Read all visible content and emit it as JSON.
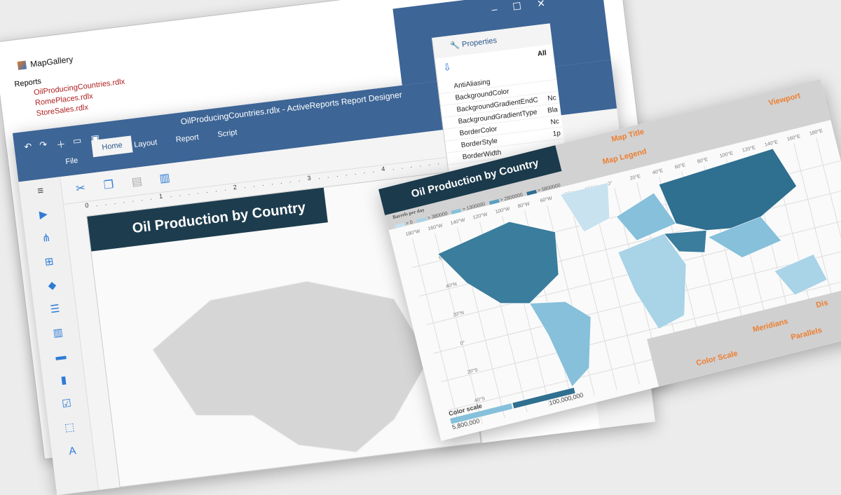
{
  "gallery": {
    "title": "MapGallery",
    "root": "Reports",
    "files": [
      "OilProducingCountries.rdlx",
      "RomePlaces.rdlx",
      "StoreSales.rdlx"
    ]
  },
  "designer": {
    "title": "OilProducingCountries.rdlx -  ActiveReports Report Designer",
    "tabs": {
      "file": "File",
      "home": "Home",
      "layout": "Layout",
      "report": "Report",
      "script": "Script"
    },
    "ruler": "0 . . . . . . . 1 . . . . . . . 2 . . . . . . . 3 . . . . . . . 4 . . . . . . . 5 . . . . . . .",
    "report_title": "Oil Production by Country",
    "properties": {
      "title": "Properties",
      "column": "All",
      "rows": [
        {
          "name": "AntiAliasing",
          "value": ""
        },
        {
          "name": "BackgroundColor",
          "value": ""
        },
        {
          "name": "BackgroundGradientEndC",
          "value": "Nc"
        },
        {
          "name": "BackgroundGradientType",
          "value": "Bla"
        },
        {
          "name": "BorderColor",
          "value": "Nc"
        },
        {
          "name": "BorderStyle",
          "value": "1p"
        },
        {
          "name": "BorderWidth",
          "value": ""
        }
      ]
    }
  },
  "map": {
    "title": "Oil Production by Country",
    "legend_title": "Barrels per day",
    "legend": [
      {
        "label": "> 0",
        "color": "#c8e2ef"
      },
      {
        "label": "> 380000",
        "color": "#a9d3e6"
      },
      {
        "label": "> 1300000",
        "color": "#86c0da"
      },
      {
        "label": "> 2800000",
        "color": "#5a9ebf"
      },
      {
        "label": "> 5800000",
        "color": "#2f6f90"
      }
    ],
    "meridians": [
      "180°W",
      "160°W",
      "140°W",
      "120°W",
      "100°W",
      "80°W",
      "60°W",
      "40°W",
      "20°W",
      "0°",
      "20°E",
      "40°E",
      "60°E",
      "80°E",
      "100°E",
      "120°E",
      "140°E",
      "160°E",
      "180°E"
    ],
    "parallels": [
      "60°N",
      "40°N",
      "20°N",
      "0°",
      "20°S",
      "40°S"
    ],
    "color_scale": {
      "title": "Color scale",
      "max": "100,000,000",
      "mid": "5,800,000"
    },
    "annotations": {
      "map_title": "Map Title",
      "map_legend": "Map Legend",
      "viewport": "Viewport",
      "meridians": "Meridians",
      "parallels": "Parallels",
      "color_scale": "Color Scale",
      "distance": "Dis"
    }
  }
}
